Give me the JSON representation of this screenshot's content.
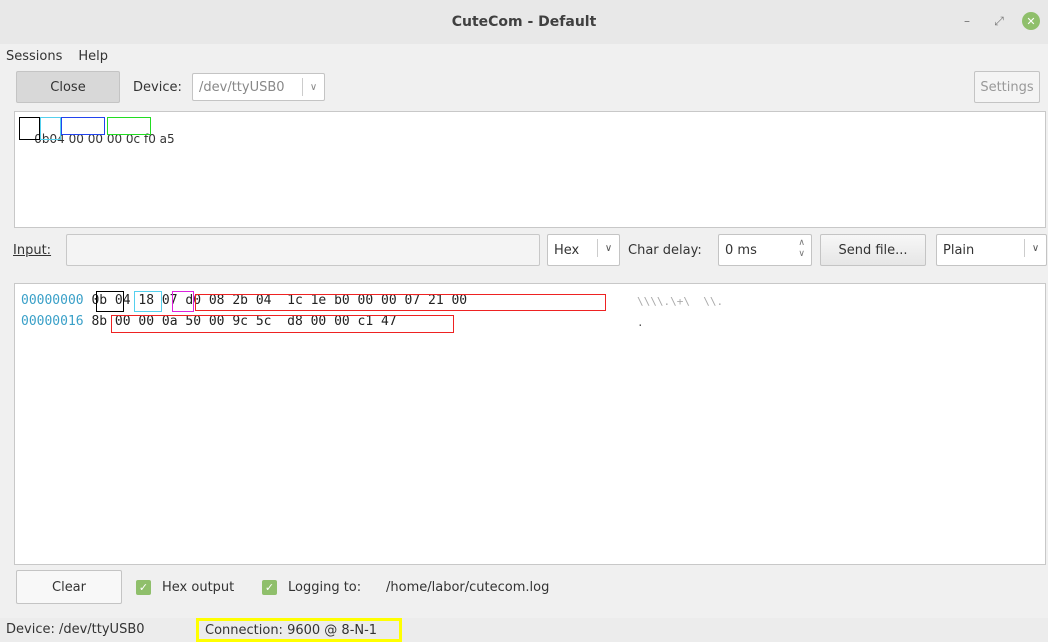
{
  "window": {
    "title": "CuteCom - Default"
  },
  "menu": {
    "sessions": "Sessions",
    "help": "Help"
  },
  "toolbar": {
    "close_label": "Close",
    "device_label": "Device:",
    "device_value": "/dev/ttyUSB0",
    "settings_label": "Settings"
  },
  "top_pane": {
    "bytes": [
      "0b",
      "04",
      "00 00",
      "00 0c",
      "f0 a5"
    ]
  },
  "input_row": {
    "input_label": "Input:",
    "input_value": "",
    "format": "Hex",
    "char_delay_label": "Char delay:",
    "char_delay_value": "0 ms",
    "send_file_label": "Send file...",
    "line_end": "Plain"
  },
  "output": {
    "lines": [
      {
        "addr": "00000000",
        "hex": "0b 04 18 07 d0 08 2b 04  1c 1e b0 00 00 07 21 00",
        "ascii": "\\\\\\\\.\\+\\  \\\\."
      },
      {
        "addr": "00000016",
        "hex": "8b 00 00 0a 50 00 9c 5c  d8 00 00 c1 47",
        "ascii": "."
      }
    ]
  },
  "bottom": {
    "clear_label": "Clear",
    "hex_output_label": "Hex output",
    "logging_label": "Logging to:",
    "logging_path": "/home/labor/cutecom.log"
  },
  "status": {
    "device": "Device:  /dev/ttyUSB0",
    "connection": "Connection:  9600 @ 8-N-1"
  },
  "colors": {
    "accent_green": "#8fbf6b",
    "address_blue": "#3aa0c8",
    "highlight_yellow": "#ffff00"
  }
}
